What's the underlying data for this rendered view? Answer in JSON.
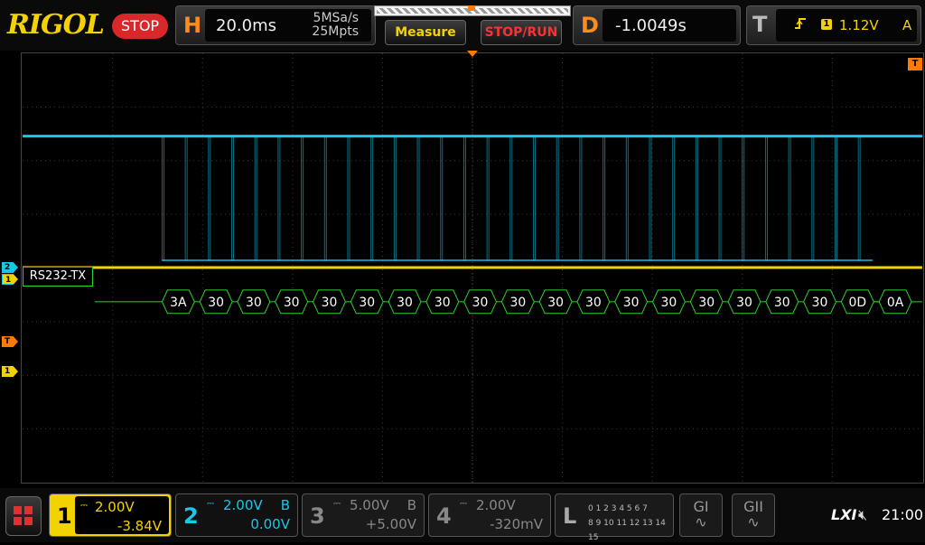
{
  "brand": "RIGOL",
  "run_state": "STOP",
  "horizontal": {
    "letter": "H",
    "timebase": "20.0ms",
    "sample_rate": "5MSa/s",
    "mem_depth": "25Mpts"
  },
  "buttons": {
    "measure": "Measure",
    "stop_run": "STOP/RUN"
  },
  "delay": {
    "letter": "D",
    "value": "-1.0049s"
  },
  "trigger": {
    "letter": "T",
    "source": "1",
    "level": "1.12V",
    "mode": "A",
    "marker": "T"
  },
  "markers": {
    "ch2": "2",
    "ch1": "1",
    "trigger": "T",
    "ch1_level": "1"
  },
  "decoder": {
    "label": "RS232-TX",
    "bytes": [
      "3A",
      "30",
      "30",
      "30",
      "30",
      "30",
      "30",
      "30",
      "30",
      "30",
      "30",
      "30",
      "30",
      "30",
      "30",
      "30",
      "30",
      "30",
      "0D",
      "0A"
    ]
  },
  "channels": [
    {
      "id": "1",
      "scale": "2.00V",
      "flag": "",
      "offset": "-3.84V",
      "color": "#f2d200"
    },
    {
      "id": "2",
      "scale": "2.00V",
      "flag": "B",
      "offset": "0.00V",
      "color": "#18c8e6"
    },
    {
      "id": "3",
      "scale": "5.00V",
      "flag": "B",
      "offset": "+5.00V",
      "color": "#888888"
    },
    {
      "id": "4",
      "scale": "2.00V",
      "flag": "",
      "offset": "-320mV",
      "color": "#888888"
    }
  ],
  "logic": {
    "letter": "L",
    "row1": "0 1 2 3   4 5 6 7",
    "row2": "8 9 10 11 12 13 14 15"
  },
  "generators": {
    "g1": "GI",
    "g2": "GII"
  },
  "status": {
    "lxi": "LXI",
    "time": "21:00"
  }
}
